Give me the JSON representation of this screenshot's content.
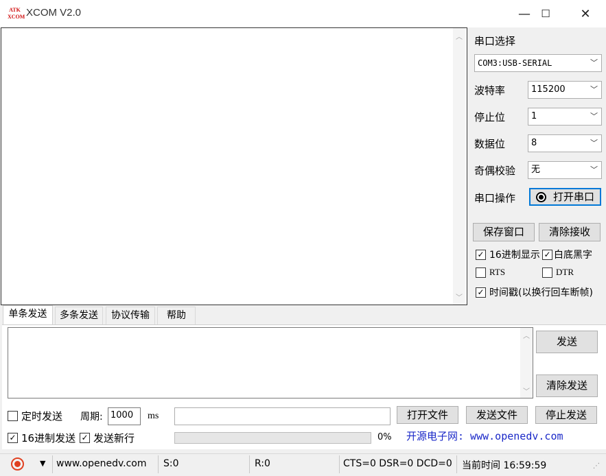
{
  "window": {
    "logo_line1": "ATK",
    "logo_line2": "XCOM",
    "title": "XCOM V2.0",
    "minimize": "—",
    "maximize": "☐",
    "close": "✕"
  },
  "serial": {
    "port_select_label": "串口选择",
    "port_value": "COM3:USB-SERIAL",
    "baud_label": "波特率",
    "baud_value": "115200",
    "stopbits_label": "停止位",
    "stopbits_value": "1",
    "databits_label": "数据位",
    "databits_value": "8",
    "parity_label": "奇偶校验",
    "parity_value": "无",
    "operation_label": "串口操作",
    "open_button": "打开串口"
  },
  "receive": {
    "save_window": "保存窗口",
    "clear_receive": "清除接收",
    "hex_display": "16进制显示",
    "hex_display_checked": true,
    "white_bg": "白底黑字",
    "white_bg_checked": true,
    "rts": "RTS",
    "rts_checked": false,
    "dtr": "DTR",
    "dtr_checked": false,
    "timestamp": "时间戳(以换行回车断帧)",
    "timestamp_checked": true
  },
  "tabs": [
    "单条发送",
    "多条发送",
    "协议传输",
    "帮助"
  ],
  "send": {
    "send_button": "发送",
    "clear_send": "清除发送",
    "timed_send": "定时发送",
    "timed_send_checked": false,
    "period_label": "周期:",
    "period_value": "1000",
    "period_unit": "ms",
    "open_file": "打开文件",
    "send_file": "发送文件",
    "stop_send": "停止发送",
    "hex_send": "16进制发送",
    "hex_send_checked": true,
    "send_newline": "发送新行",
    "send_newline_checked": true,
    "progress_percent": "0%",
    "banner": "开源电子网: www.openedv.com"
  },
  "status": {
    "website": "www.openedv.com",
    "sent": "S:0",
    "received": "R:0",
    "signals": "CTS=0 DSR=0 DCD=0",
    "time": "当前时间 16:59:59"
  },
  "colors": {
    "accent_border": "#0078d7",
    "banner_text": "#1a28c8",
    "logo_red": "#d01010"
  }
}
